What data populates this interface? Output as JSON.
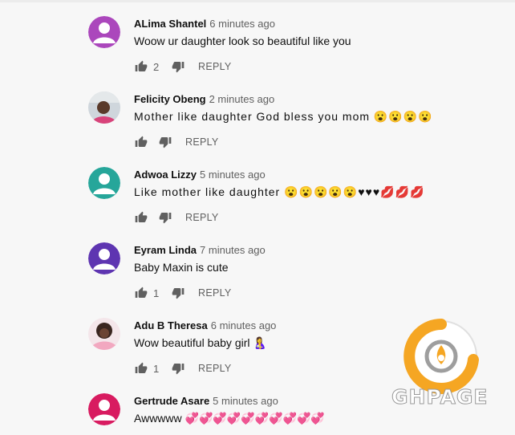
{
  "comments": [
    {
      "author": "ALima Shantel",
      "time": "6 minutes ago",
      "text": "Woow ur daughter look so beautiful like you",
      "likes": "2",
      "reply": "REPLY",
      "avatar_color": "#ab47bc"
    },
    {
      "author": "Felicity Obeng",
      "time": "2 minutes ago",
      "text": "Mother like daughter God bless you mom 😮😮😮😮",
      "likes": "",
      "reply": "REPLY",
      "avatar_color": "#d8b49a"
    },
    {
      "author": "Adwoa Lizzy",
      "time": "5 minutes ago",
      "text": "Like mother like daughter 😮😮😮😮😮♥♥♥💋💋💋",
      "likes": "",
      "reply": "REPLY",
      "avatar_color": "#26a69a"
    },
    {
      "author": "Eyram Linda",
      "time": "7 minutes ago",
      "text": "Baby Maxin is cute",
      "likes": "1",
      "reply": "REPLY",
      "avatar_color": "#5e35b1"
    },
    {
      "author": "Adu B Theresa",
      "time": "6 minutes ago",
      "text": "Wow beautiful baby girl 🤱",
      "likes": "1",
      "reply": "REPLY",
      "avatar_color": "#e8a0b0"
    },
    {
      "author": "Gertrude Asare",
      "time": "5 minutes ago",
      "text": "Awwwww 💞💞💞💞💞💞💞💞💞💞",
      "likes": "",
      "reply": "REPLY",
      "avatar_color": "#d81b60"
    }
  ],
  "watermark": {
    "text": "GHPAGE",
    "primary_color": "#f5a623",
    "secondary_color": "#9e9e9e"
  },
  "icons": {
    "like": "thumbs-up-icon",
    "dislike": "thumbs-down-icon",
    "avatar": "person-avatar-icon"
  }
}
